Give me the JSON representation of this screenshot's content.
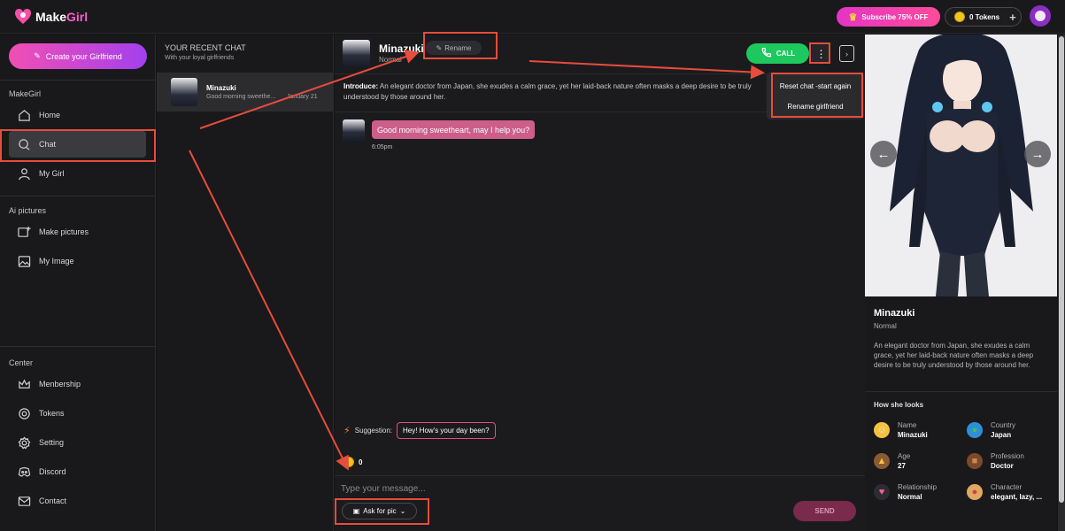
{
  "brand": {
    "prefix": "Make",
    "suffix": "Girl"
  },
  "topbar": {
    "subscribe_label": "Subscribe 75% OFF",
    "tokens_label": "0 Tokens"
  },
  "sidebar": {
    "create_label": "Create your Girlfriend",
    "section_makegirl": "MakeGirl",
    "section_ai": "Ai pictures",
    "section_center": "Center",
    "items": [
      {
        "label": "Home",
        "icon": "home-icon"
      },
      {
        "label": "Chat",
        "icon": "chat-icon",
        "active": true
      },
      {
        "label": "My Girl",
        "icon": "person-icon"
      },
      {
        "label": "Make pictures",
        "icon": "image-plus-icon"
      },
      {
        "label": "My Image",
        "icon": "image-icon"
      },
      {
        "label": "Menbership",
        "icon": "crown-icon"
      },
      {
        "label": "Tokens",
        "icon": "coin-icon"
      },
      {
        "label": "Setting",
        "icon": "gear-icon"
      },
      {
        "label": "Discord",
        "icon": "discord-icon"
      },
      {
        "label": "Contact",
        "icon": "mail-icon"
      }
    ]
  },
  "chatlist": {
    "title": "YOUR RECENT CHAT",
    "subtitle": "With your loyal girlfriends",
    "items": [
      {
        "name": "Minazuki",
        "preview": "Good morning sweethe...",
        "date": "January 21"
      }
    ]
  },
  "chat": {
    "name": "Minazuki",
    "status": "Normal",
    "rename_label": "Rename",
    "call_label": "CALL",
    "intro_label": "Introduce:",
    "intro_text": "An elegant doctor from Japan, she exudes a calm grace, yet her laid-back nature often masks a deep desire to be truly understood by those around her.",
    "messages": [
      {
        "text": "Good morning sweetheart, may I help you?",
        "time": "6:05pm"
      }
    ],
    "suggestion_label": "Suggestion:",
    "suggestion_text": "Hey! How's your day been?",
    "token_count": "0",
    "input_placeholder": "Type your message...",
    "askpic_label": "Ask for pic",
    "send_label": "SEND"
  },
  "menu": {
    "items": [
      "Reset chat -start again",
      "Rename girlfriend"
    ]
  },
  "profile": {
    "name": "Minazuki",
    "status": "Normal",
    "description": "An elegant doctor from Japan, she exudes a calm grace, yet her laid-back nature often masks a deep desire to be truly understood by those around her.",
    "looks_title": "How she looks",
    "attributes": [
      {
        "key": "Name",
        "value": "Minazuki",
        "icon": "face-icon"
      },
      {
        "key": "Country",
        "value": "Japan",
        "icon": "globe-icon"
      },
      {
        "key": "Age",
        "value": "27",
        "icon": "cake-icon"
      },
      {
        "key": "Profession",
        "value": "Doctor",
        "icon": "briefcase-icon"
      },
      {
        "key": "Relationship",
        "value": "Normal",
        "icon": "hearts-icon"
      },
      {
        "key": "Character",
        "value": "elegant, lazy, ...",
        "icon": "palette-icon"
      }
    ]
  },
  "colors": {
    "accent_pink": "#e534c4",
    "call_green": "#1ec85f",
    "annotation_red": "#e74c3c"
  }
}
